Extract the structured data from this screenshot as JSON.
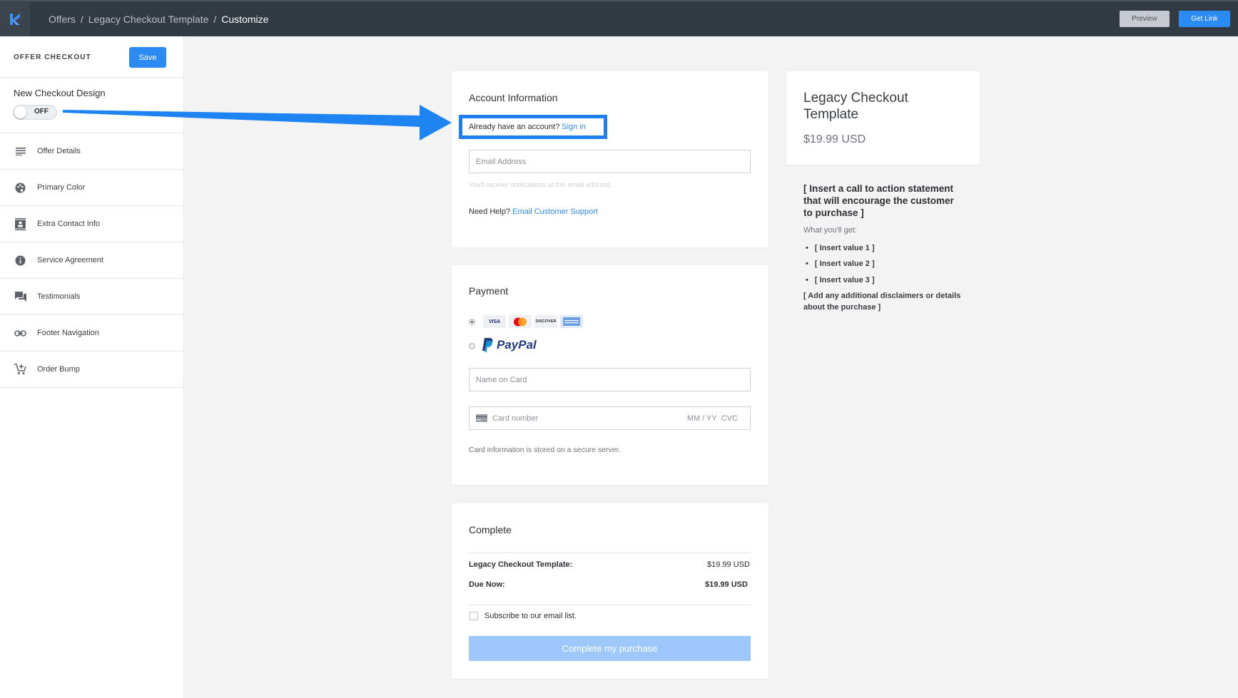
{
  "topbar": {
    "breadcrumb": [
      "Offers",
      "Legacy Checkout Template",
      "Customize"
    ],
    "separator": "/",
    "preview_label": "Preview",
    "get_link_label": "Get Link"
  },
  "sidebar": {
    "title": "OFFER CHECKOUT",
    "save_label": "Save",
    "toggle_label": "New Checkout Design",
    "toggle_state": "OFF",
    "items": [
      {
        "label": "Offer Details",
        "icon": "list-icon"
      },
      {
        "label": "Primary Color",
        "icon": "palette-icon"
      },
      {
        "label": "Extra Contact Info",
        "icon": "contact-card-icon"
      },
      {
        "label": "Service Agreement",
        "icon": "info-icon"
      },
      {
        "label": "Testimonials",
        "icon": "chat-icon"
      },
      {
        "label": "Footer Navigation",
        "icon": "link-icon"
      },
      {
        "label": "Order Bump",
        "icon": "cart-plus-icon"
      }
    ]
  },
  "account": {
    "title": "Account Information",
    "already_text": "Already have an account?",
    "sign_in_label": "Sign in",
    "email_placeholder": "Email Address",
    "email_hint": "You'll receive notifications at this email address.",
    "help_text": "Need Help?",
    "support_link": "Email Customer Support"
  },
  "payment": {
    "title": "Payment",
    "cards": [
      "VISA",
      "mastercard",
      "DISCOVER",
      "AMERICAN EXPRESS"
    ],
    "paypal_label": "PayPal",
    "name_placeholder": "Name on Card",
    "card_placeholder": "Card number",
    "expiry_cvc_placeholder": "MM / YY  CVC",
    "secure_note": "Card information is stored on a secure server."
  },
  "complete": {
    "title": "Complete",
    "line_item_label": "Legacy Checkout Template:",
    "line_item_value": "$19.99 USD",
    "due_label": "Due Now:",
    "due_value": "$19.99 USD",
    "subscribe_label": "Subscribe to our email list.",
    "button_label": "Complete my purchase"
  },
  "product": {
    "title": "Legacy Checkout Template",
    "price": "$19.99 USD",
    "cta": "[ Insert a call to action statement that will encourage the customer to purchase ]",
    "get_label": "What you'll get:",
    "values": [
      "[ Insert value 1 ]",
      "[ Insert value 2 ]",
      "[ Insert value 3 ]"
    ],
    "disclaimer": "[ Add any additional disclaimers or details about the purchase ]"
  },
  "colors": {
    "accent": "#2c8bf2",
    "topbar": "#323a44",
    "highlight": "#1e7ef2"
  }
}
